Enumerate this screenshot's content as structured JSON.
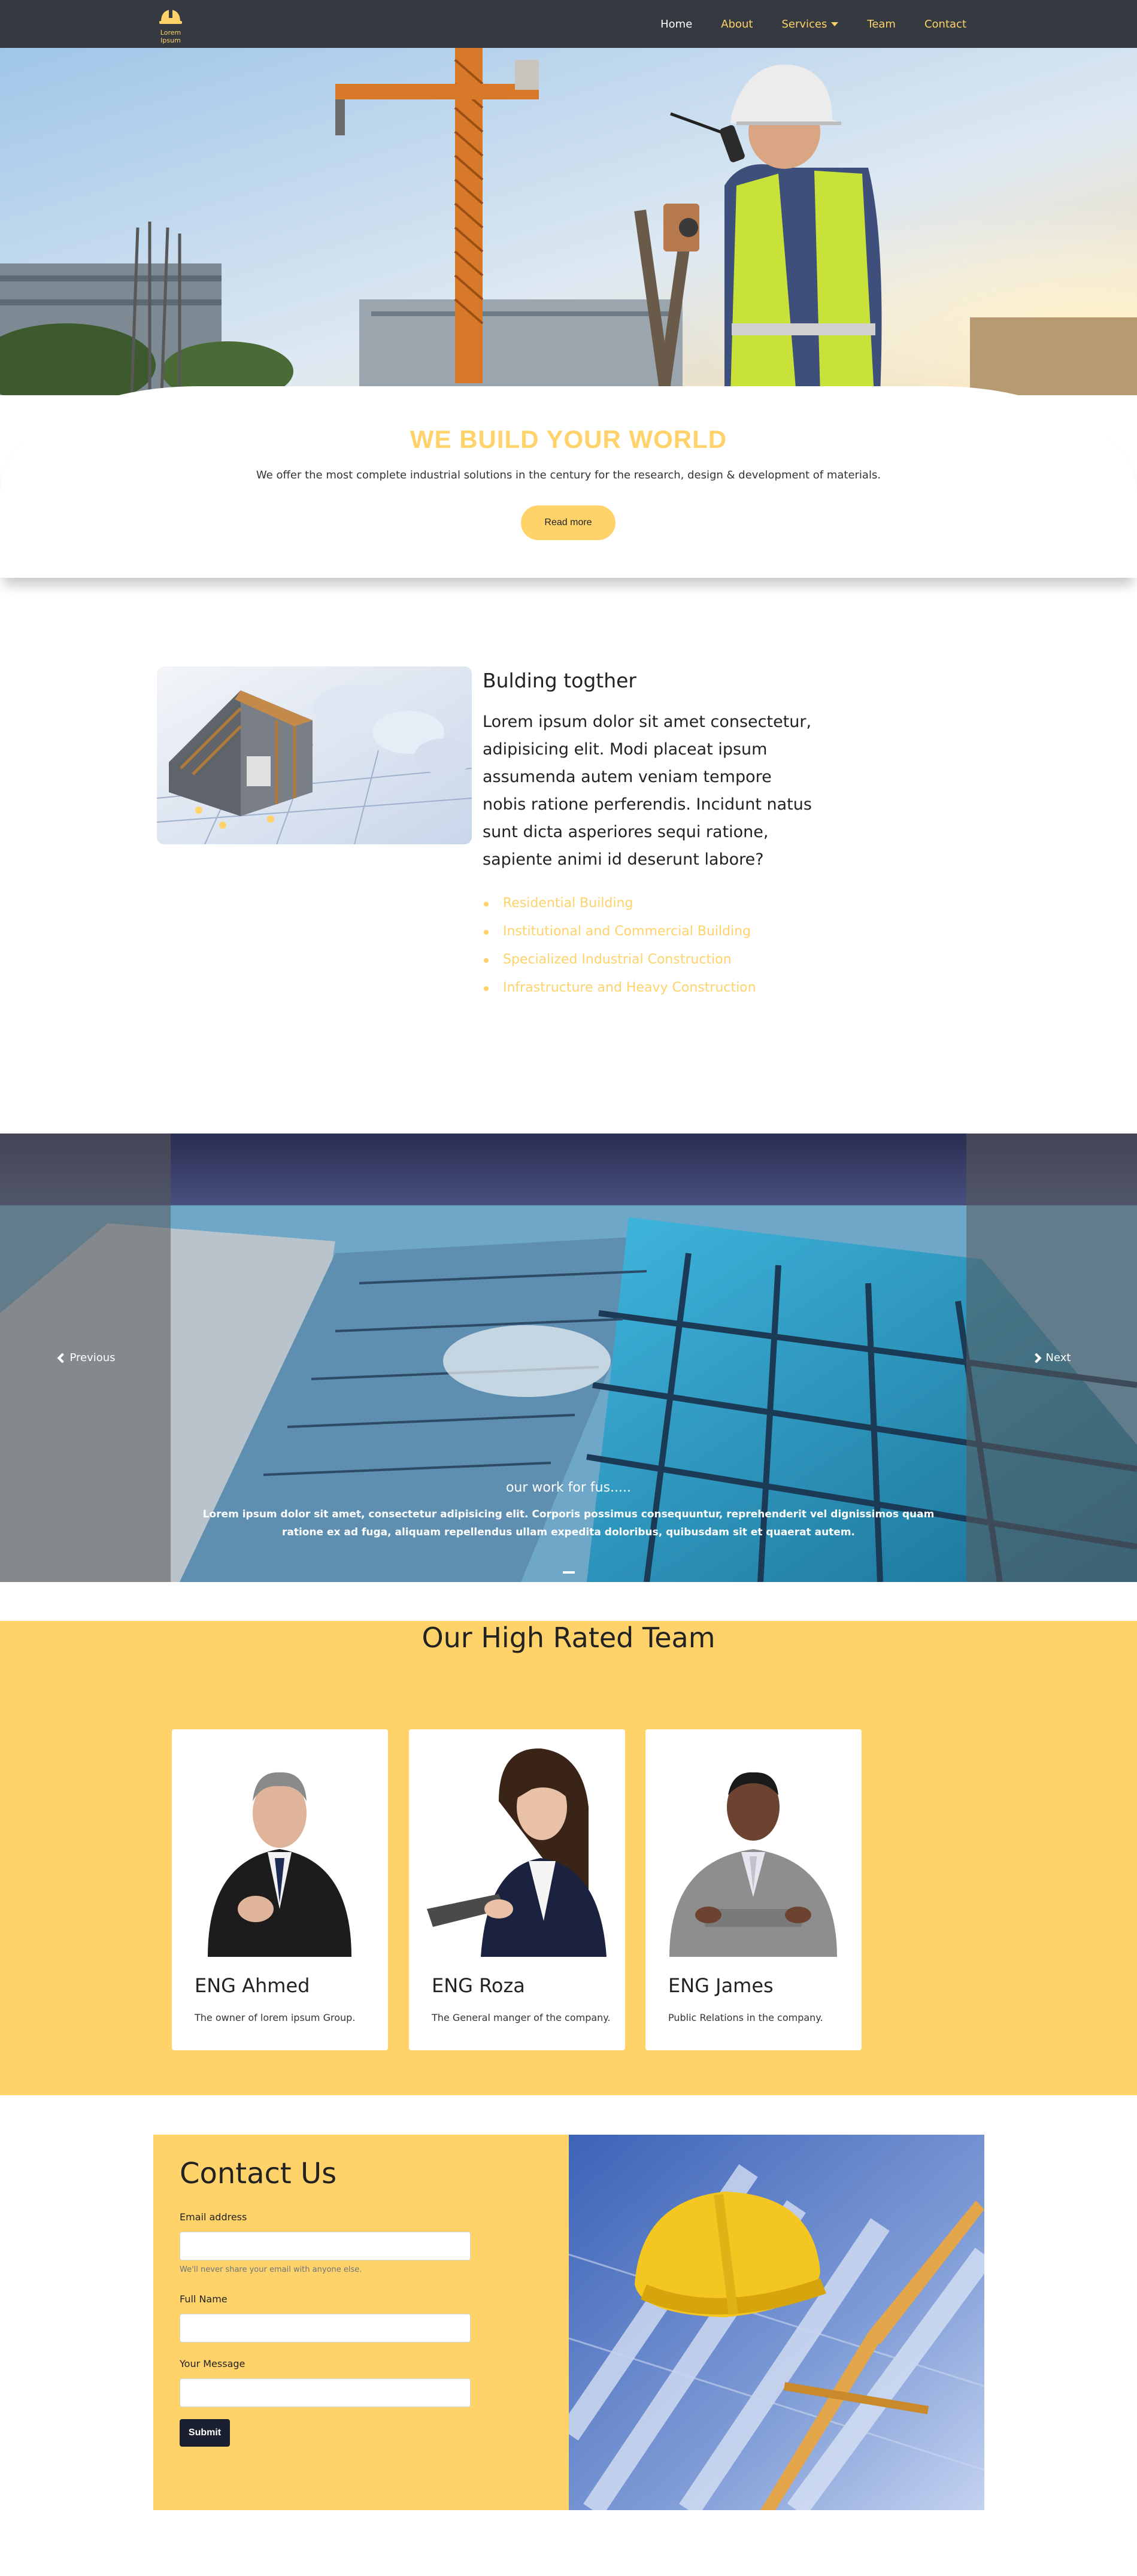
{
  "nav": {
    "logo_text": "Lorem Ipsum",
    "links": [
      "Home",
      "About",
      "Services",
      "Team",
      "Contact"
    ]
  },
  "hero": {
    "title": "WE BUILD YOUR WORLD",
    "subtitle": "We offer the most complete industrial solutions in the century for the research, design & development of materials.",
    "button": "Read more"
  },
  "about": {
    "title": "Bulding togther",
    "text": "Lorem ipsum dolor sit amet consectetur, adipisicing elit. Modi placeat ipsum assumenda autem veniam tempore nobis ratione perferendis. Incidunt natus sunt dicta asperiores sequi ratione, sapiente animi id deserunt labore?",
    "list": [
      "Residential Building",
      "Institutional and Commercial Building",
      "Specialized Industrial Construction",
      "Infrastructure and Heavy Construction"
    ]
  },
  "carousel": {
    "prev": "Previous",
    "next": "Next",
    "caption_title": "our work for fus.....",
    "caption_text": "Lorem ipsum dolor sit amet, consectetur adipisicing elit. Corporis possimus consequuntur, reprehenderit vel dignissimos quam ratione ex ad fuga, aliquam repellendus ullam expedita doloribus, quibusdam sit et quaerat autem."
  },
  "team": {
    "title": "Our High Rated Team",
    "members": [
      {
        "name": "ENG Ahmed",
        "role": "The owner of lorem ipsum Group."
      },
      {
        "name": "ENG Roza",
        "role": "The General manger of the company."
      },
      {
        "name": "ENG James",
        "role": "Public Relations in the company."
      }
    ]
  },
  "contact": {
    "title": "Contact Us",
    "email_label": "Email address",
    "email_help": "We'll never share your email with anyone else.",
    "name_label": "Full Name",
    "message_label": "Your Message",
    "submit": "Submit"
  },
  "colors": {
    "accent": "#ffd26a",
    "navbar": "#343a40",
    "submit": "#1b2030"
  }
}
